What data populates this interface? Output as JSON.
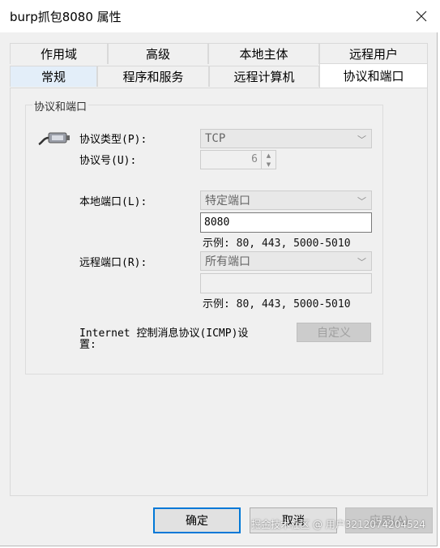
{
  "window": {
    "title": "burp抓包8080 属性"
  },
  "tabs_row1": [
    "作用域",
    "高级",
    "本地主体",
    "远程用户"
  ],
  "tabs_row2": [
    "常规",
    "程序和服务",
    "远程计算机",
    "协议和端口"
  ],
  "group": {
    "label": "协议和端口"
  },
  "protocol_type": {
    "label": "协议类型(P):",
    "value": "TCP"
  },
  "protocol_number": {
    "label": "协议号(U):",
    "value": "6"
  },
  "local_port": {
    "label": "本地端口(L):",
    "mode": "特定端口",
    "value": "8080",
    "example": "示例: 80, 443, 5000-5010"
  },
  "remote_port": {
    "label": "远程端口(R):",
    "mode": "所有端口",
    "value": "",
    "example": "示例: 80, 443, 5000-5010"
  },
  "icmp": {
    "label_line1": "Internet 控制消息协议(ICMP)设",
    "label_line2": "置:",
    "button": "自定义"
  },
  "footer": {
    "ok": "确定",
    "cancel": "取消",
    "apply": "应用(A)"
  },
  "watermark": "掘金技术社区 @ 用户3212074204524"
}
